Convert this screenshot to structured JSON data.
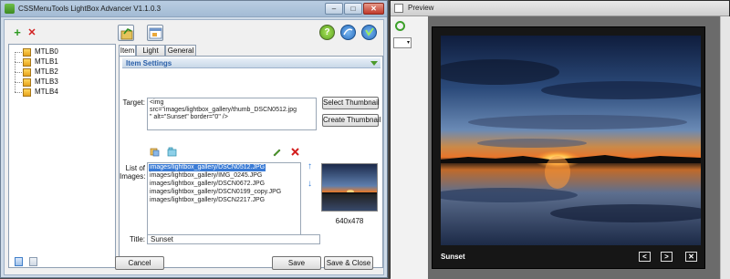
{
  "app": {
    "title": "CSSMenuTools LightBox Advancer V1.1.0.3",
    "window_controls": {
      "minimize": "–",
      "maximize": "□",
      "close": "✕"
    }
  },
  "toolbar": {
    "add_icon": "+",
    "delete_icon": "✕",
    "help_icon": "?"
  },
  "tree": {
    "items": [
      "MTLB0",
      "MTLB1",
      "MTLB2",
      "MTLB3",
      "MTLB4"
    ]
  },
  "tabs": [
    "Item",
    "Light Box",
    "General"
  ],
  "item_settings": {
    "header": "Item Settings",
    "target_label": "Target:",
    "target_value": "<img\nsrc=\"images/lightbox_gallery/thumb_DSCN0512.jpg\n\" alt=\"Sunset\" border=\"0\" />",
    "select_thumbnail": "Select Thumbnail",
    "create_thumbnail": "Create Thumbnail",
    "images_label_1": "List of",
    "images_label_2": "Images:",
    "images": [
      "images/lightbox_gallery/DSCN0512.JPG",
      "images/lightbox_gallery/IMG_0245.JPG",
      "images/lightbox_gallery/DSCN0672.JPG",
      "images/lightbox_gallery/DSCN0199_copy.JPG",
      "images/lightbox_gallery/DSCN2217.JPG"
    ],
    "selected_index": 0,
    "thumb_dims": "640x478",
    "title_label": "Title:",
    "title_value": "Sunset"
  },
  "footer": {
    "cancel": "Cancel",
    "save": "Save",
    "save_close": "Save & Close"
  },
  "preview": {
    "title": "Preview",
    "caption": "Sunset",
    "prev": "<",
    "next": ">",
    "close": "✕"
  }
}
